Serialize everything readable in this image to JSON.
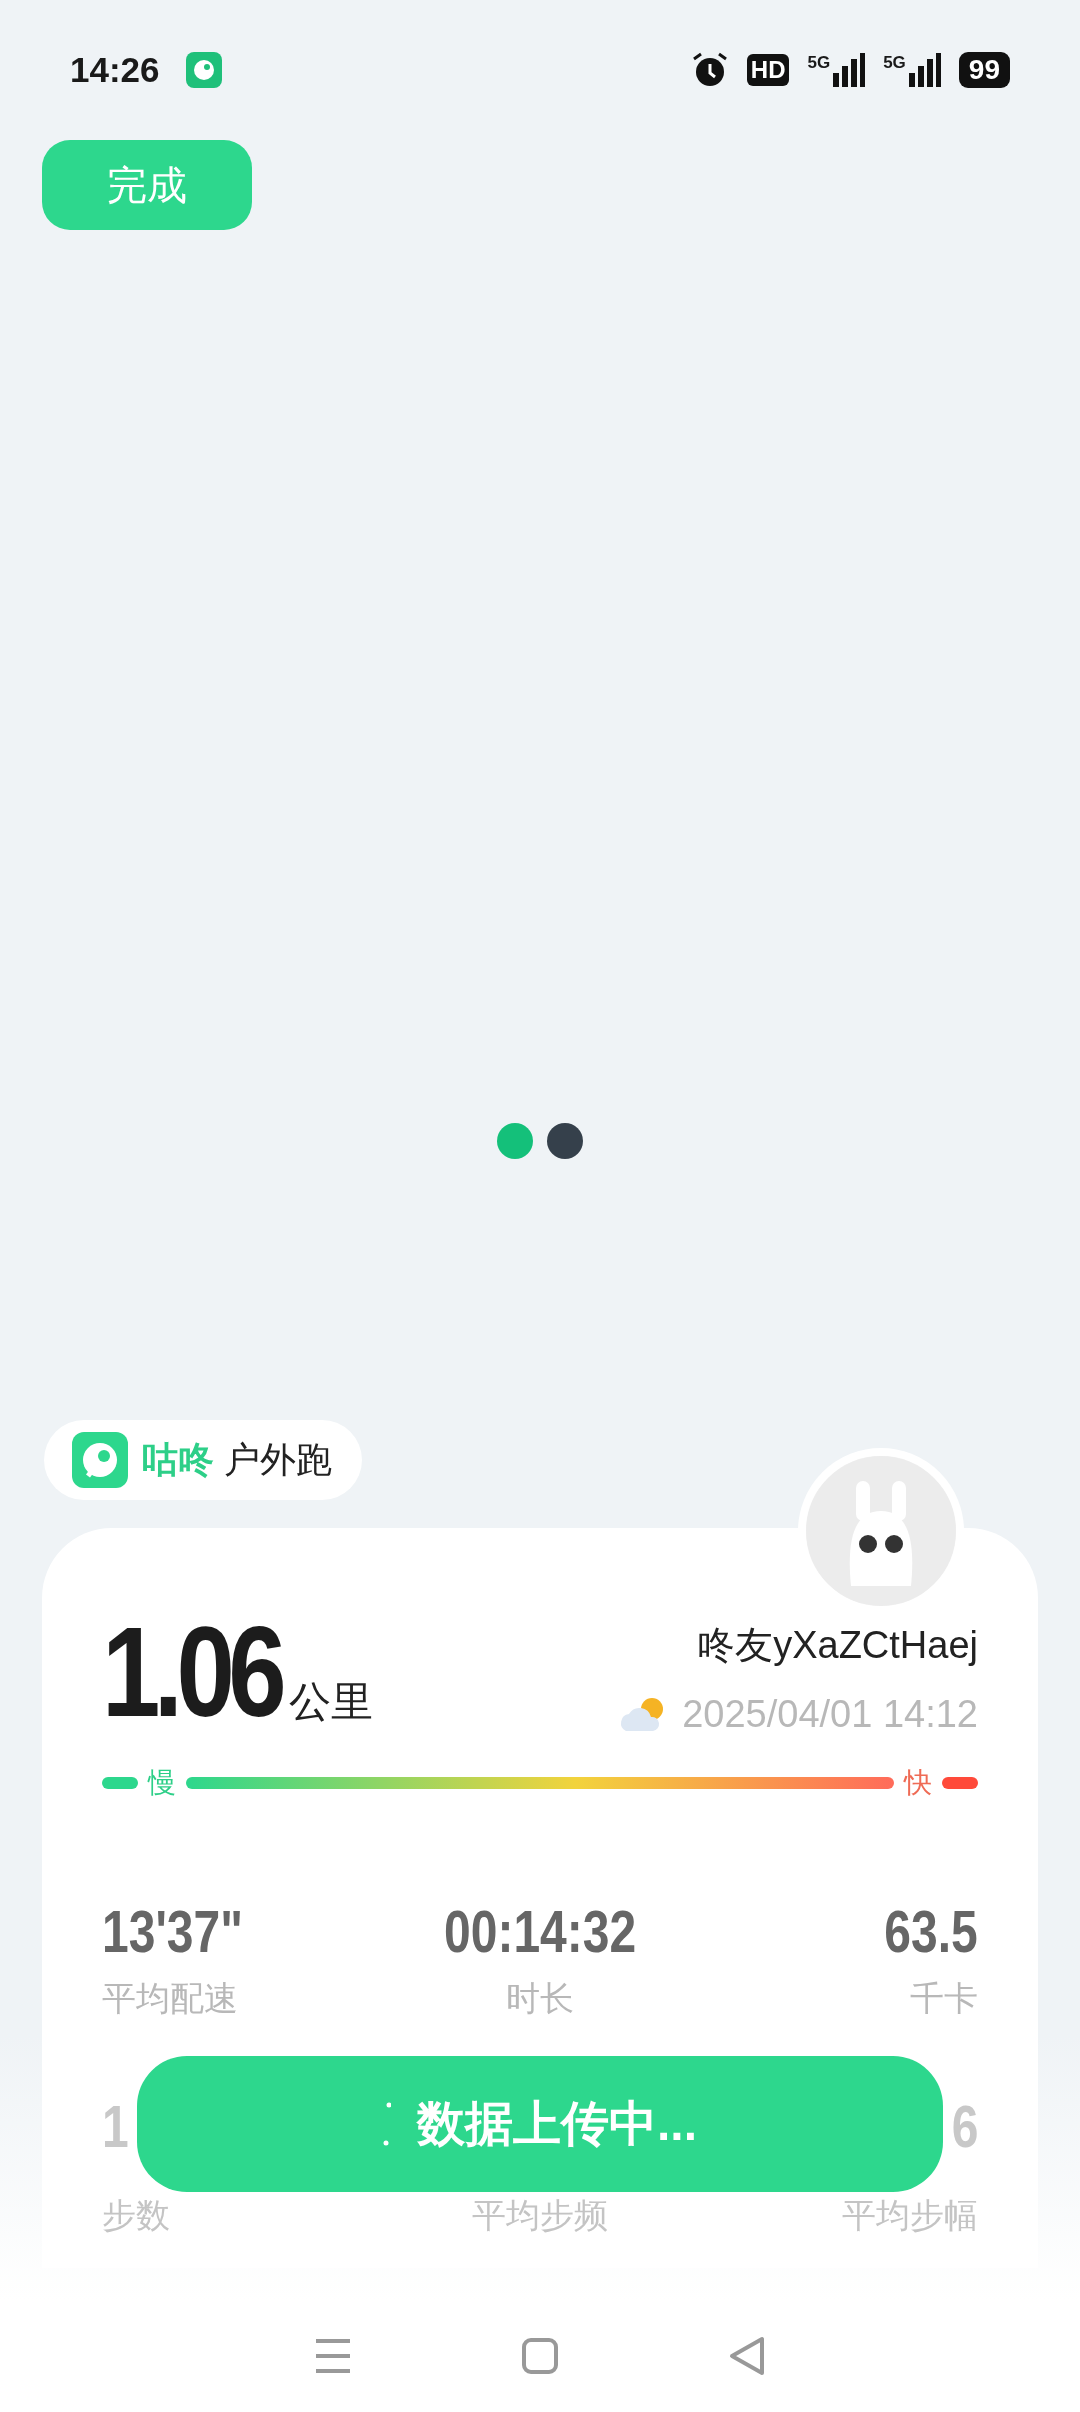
{
  "status_bar": {
    "time": "14:26",
    "battery": "99",
    "network_1": "5G",
    "network_2": "5G",
    "hd": "HD"
  },
  "done_button": {
    "label": "完成"
  },
  "pager_dots": [
    {
      "selected": true
    },
    {
      "selected": false
    }
  ],
  "app_tag": {
    "brand": "咕咚",
    "activity": "户外跑"
  },
  "summary": {
    "distance": "1.06",
    "unit": "公里",
    "user": "咚友yXaZCtHaej",
    "datetime": "2025/04/01 14:12",
    "slow_label": "慢",
    "fast_label": "快"
  },
  "stats": [
    {
      "value": "13'37\"",
      "label": "平均配速"
    },
    {
      "value": "00:14:32",
      "label": "时长"
    },
    {
      "value": "63.5",
      "label": "千卡"
    },
    {
      "value": "1",
      "label": "步数"
    },
    {
      "label": "平均步频"
    },
    {
      "value": "6",
      "label": "平均步幅"
    }
  ],
  "toast": {
    "text": "数据上传中..."
  }
}
